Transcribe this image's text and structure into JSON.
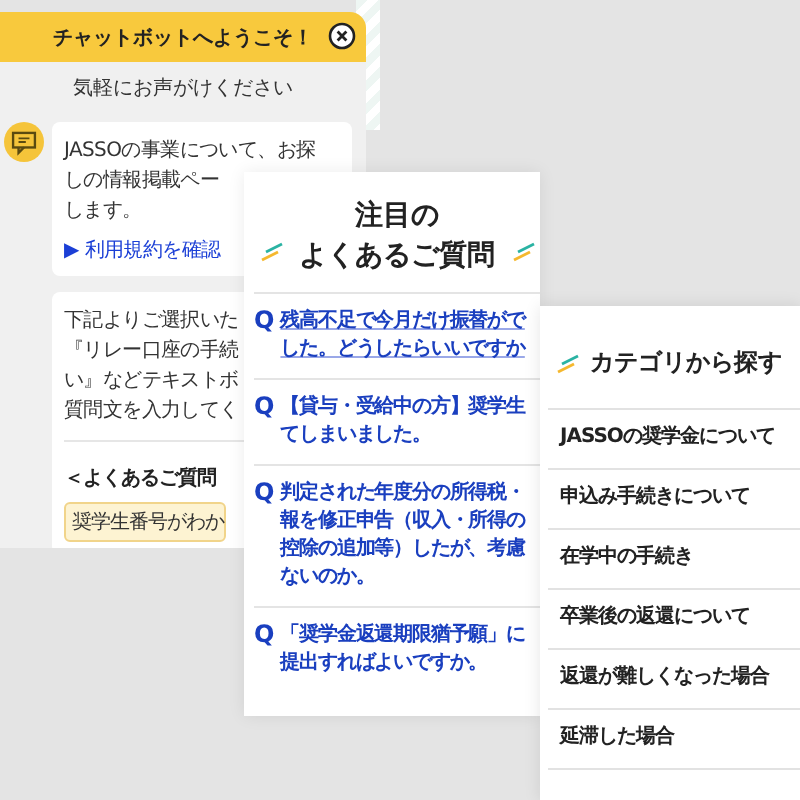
{
  "chat": {
    "title": "チャットボットへようこそ！",
    "subtitle": "気軽にお声がけください",
    "messages": [
      {
        "lines": [
          "JASSOの事業について、お探",
          "しの情報掲載ペー",
          "します。"
        ],
        "link": "▶ 利用規約を確認"
      },
      {
        "lines": [
          "下記よりご選択いた",
          "『リレー口座の手続",
          "い』などテキストボ",
          "質問文を入力してく"
        ],
        "heading": "＜よくあるご質問",
        "options": [
          "奨学生番号がわか"
        ]
      }
    ]
  },
  "faq": {
    "title_lines": [
      "注目の",
      "よくあるご質問"
    ],
    "items": [
      {
        "marker": "Q",
        "lines": [
          "残高不足で今月だけ振替がで",
          "した。どうしたらいいですか"
        ]
      },
      {
        "marker": "Q",
        "lines": [
          "【貸与・受給中の方】奨学生",
          "てしまいました。"
        ]
      },
      {
        "marker": "Q",
        "lines": [
          "判定された年度分の所得税・",
          "報を修正申告（収入・所得の",
          "控除の追加等）したが、考慮",
          "ないのか。"
        ]
      },
      {
        "marker": "Q",
        "lines": [
          "「奨学金返還期限猶予願」に",
          "提出すればよいですか。"
        ]
      }
    ]
  },
  "categories": {
    "title": "カテゴリから探す",
    "items": [
      "JASSOの奨学金について",
      "申込み手続きについて",
      "在学中の手続き",
      "卒業後の返還について",
      "返還が難しくなった場合",
      "延滞した場合"
    ]
  }
}
